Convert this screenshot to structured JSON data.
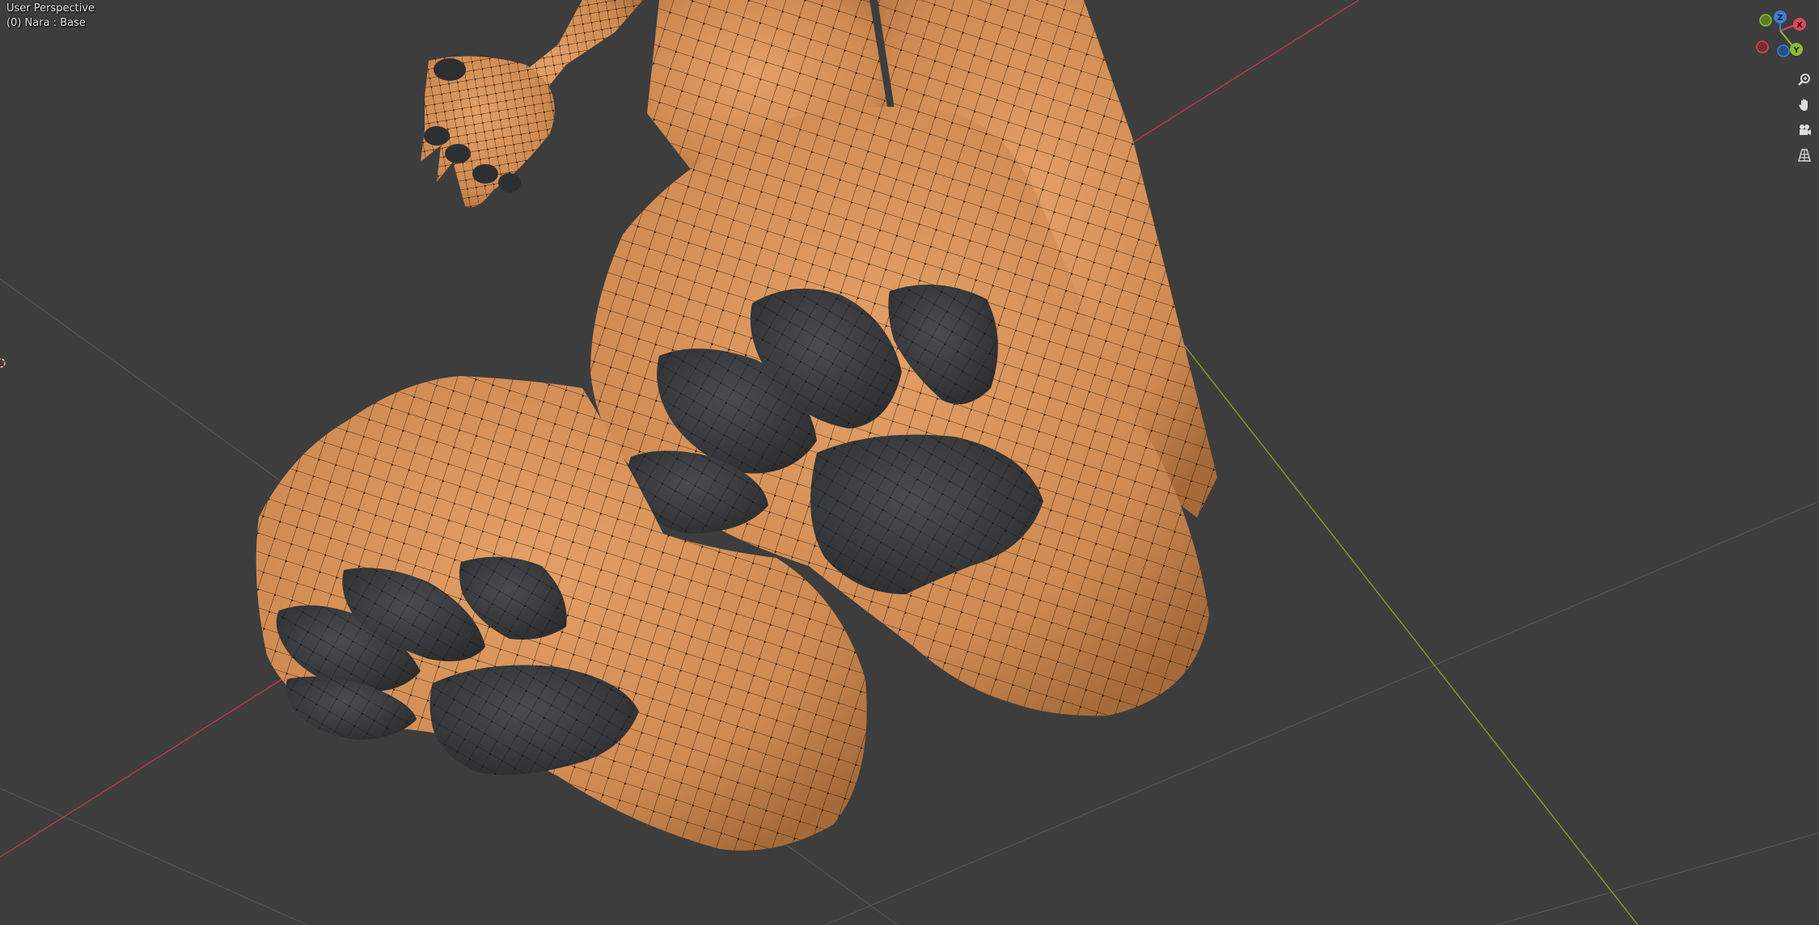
{
  "viewport": {
    "view_name": "User Perspective",
    "object_info": "(0) Nara : Base"
  },
  "gizmo": {
    "axes": [
      {
        "label": "X",
        "color": "#e0435a"
      },
      {
        "label": "Y",
        "color": "#8bbd2c"
      },
      {
        "label": "Z",
        "color": "#3d7fd7"
      }
    ]
  },
  "nav_tools": [
    {
      "name": "zoom",
      "icon": "zoom-icon"
    },
    {
      "name": "pan",
      "icon": "hand-icon"
    },
    {
      "name": "camera",
      "icon": "camera-icon"
    },
    {
      "name": "projection",
      "icon": "grid-perspective-icon"
    }
  ],
  "colors": {
    "background": "#3d3d3d",
    "skin": "#d8925a",
    "pads": "#3b3d40",
    "wire": "#1a1008",
    "grid_line": "#565656",
    "x_axis_line": "#b63a48",
    "y_axis_line": "#7a9c2a"
  }
}
